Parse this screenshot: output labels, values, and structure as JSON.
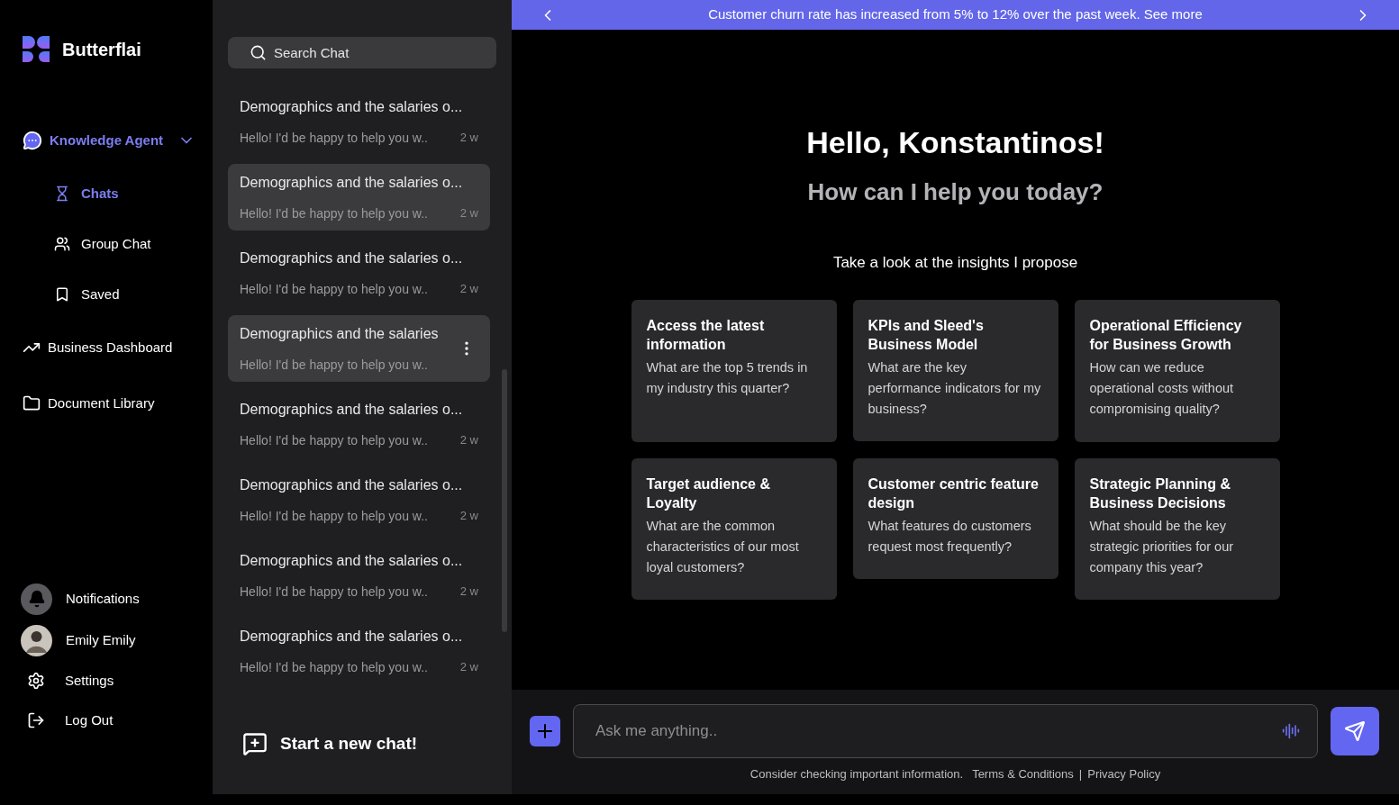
{
  "brand": {
    "name": "Butterflai"
  },
  "nav": [
    {
      "kind": "group",
      "label": "Knowledge Agent",
      "expanded": true,
      "selected": true,
      "children": [
        {
          "label": "Chats",
          "selected": true
        },
        {
          "label": "Group Chat",
          "selected": false
        },
        {
          "label": "Saved",
          "selected": false
        }
      ]
    },
    {
      "kind": "item",
      "label": "Business Dashboard",
      "selected": false
    },
    {
      "kind": "item",
      "label": "Document Library",
      "selected": false
    }
  ],
  "account": [
    {
      "kind": "notifications",
      "label": "Notifications"
    },
    {
      "kind": "avatar",
      "label": "Emily Emily"
    },
    {
      "kind": "settings",
      "label": "Settings"
    },
    {
      "kind": "logout",
      "label": "Log Out"
    }
  ],
  "search": {
    "placeholder": "Search Chat"
  },
  "chats": [
    {
      "title": "Demographics and the salaries o...",
      "preview": "Hello! I'd be happy to help you w..",
      "time": "2 w",
      "highlighted": false,
      "menu": false
    },
    {
      "title": "Demographics and the salaries o...",
      "preview": "Hello! I'd be happy to help you w..",
      "time": "2 w",
      "highlighted": true,
      "menu": false
    },
    {
      "title": "Demographics and the salaries o...",
      "preview": "Hello! I'd be happy to help you w..",
      "time": "2 w",
      "highlighted": false,
      "menu": false
    },
    {
      "title": "Demographics and the salaries",
      "preview": "Hello! I'd be happy to help you w..",
      "highlighted": true,
      "menu": true
    },
    {
      "title": "Demographics and the salaries o...",
      "preview": "Hello! I'd be happy to help you w..",
      "time": "2 w",
      "highlighted": false,
      "menu": false
    },
    {
      "title": "Demographics and the salaries o...",
      "preview": "Hello! I'd be happy to help you w..",
      "time": "2 w",
      "highlighted": false,
      "menu": false
    },
    {
      "title": "Demographics and the salaries o...",
      "preview": "Hello! I'd be happy to help you w..",
      "time": "2 w",
      "highlighted": false,
      "menu": false
    },
    {
      "title": "Demographics and the salaries o...",
      "preview": "Hello! I'd be happy to help you w..",
      "time": "2 w",
      "highlighted": false,
      "menu": false
    }
  ],
  "new_chat": {
    "label": "Start a new chat!"
  },
  "banner": {
    "text": "Customer churn rate has increased from 5% to 12% over the past week. See more"
  },
  "greeting": {
    "title": "Hello, Konstantinos!",
    "subtitle": "How can I help you today?",
    "prompt": "Take a look at the insights I propose"
  },
  "insights": [
    {
      "title": "Access the latest information",
      "question": "What are the top 5 trends in my industry this quarter?"
    },
    {
      "title": "KPIs and Sleed's Business Model",
      "question": "What are the key performance indicators for my business?"
    },
    {
      "title": "Operational Efficiency for Business Growth",
      "question": "How can we reduce operational costs without compromising quality?"
    },
    {
      "title": "Target audience & Loyalty",
      "question": "What are the common characteristics of our most loyal customers?"
    },
    {
      "title": "Customer centric feature design",
      "question": "What features do customers request most frequently?"
    },
    {
      "title": "Strategic Planning & Business Decisions",
      "question": "What should be the key strategic priorities for our company this year?"
    }
  ],
  "composer": {
    "placeholder": "Ask me anything.."
  },
  "footer": {
    "note": "Consider checking important information.",
    "links": [
      "Terms & Conditions",
      "Privacy Policy"
    ],
    "separator": "|"
  }
}
